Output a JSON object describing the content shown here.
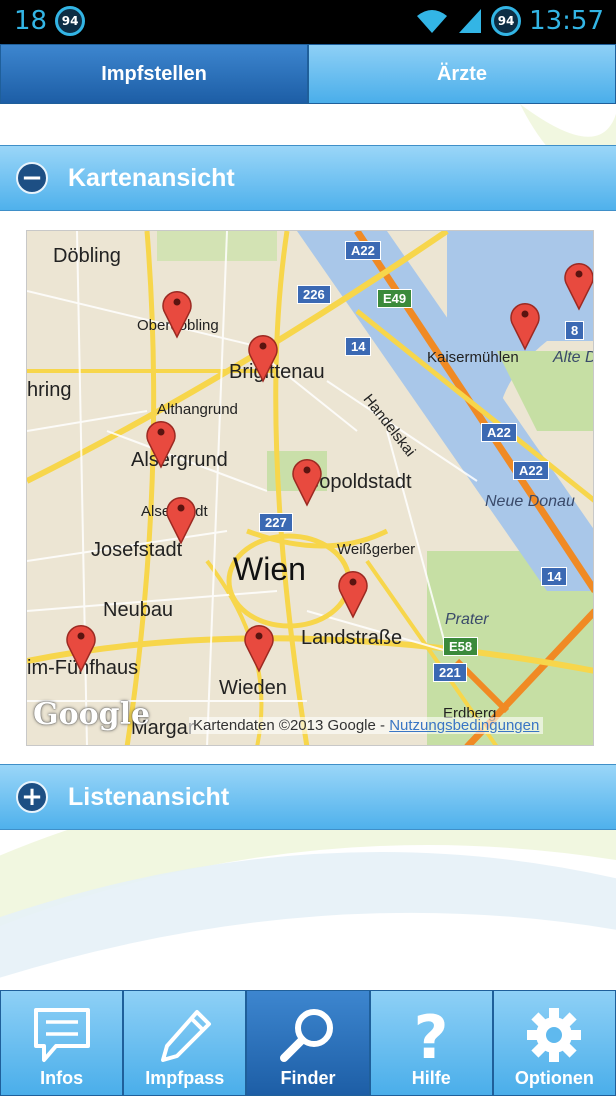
{
  "status_bar": {
    "left_number": "18",
    "badge": "94",
    "right_badge": "94",
    "time": "13:57"
  },
  "tabs": [
    {
      "label": "Impfstellen",
      "active": true
    },
    {
      "label": "Ärzte",
      "active": false
    }
  ],
  "sections": {
    "map_view": {
      "label": "Kartenansicht",
      "state_icon": "minus-icon"
    },
    "list_view": {
      "label": "Listenansicht",
      "state_icon": "plus-icon"
    }
  },
  "map": {
    "city": "Wien",
    "districts": [
      "Döbling",
      "Oberdöbling",
      "Brigittenau",
      "Kaisermühlen",
      "Alte D",
      "hring",
      "Althangrund",
      "Alsergrund",
      "Leopoldstadt",
      "Alserstadt",
      "Josefstadt",
      "Weißgerber",
      "Neubau",
      "Landstraße",
      "im-Fünfhaus",
      "Wieden",
      "Margar",
      "Erdberg",
      "Neue Donau",
      "Prater",
      "Handelskai"
    ],
    "road_shields": [
      "A22",
      "226",
      "E49",
      "14",
      "8",
      "A22",
      "A22",
      "227",
      "14",
      "E58",
      "221"
    ],
    "logo": "Google",
    "copyright": "Kartendaten ©2013 Google -",
    "terms_link": "Nutzungsbedingungen"
  },
  "bottom_nav": [
    {
      "label": "Infos",
      "icon": "message-icon",
      "active": false
    },
    {
      "label": "Impfpass",
      "icon": "pencil-icon",
      "active": false
    },
    {
      "label": "Finder",
      "icon": "search-icon",
      "active": true
    },
    {
      "label": "Hilfe",
      "icon": "question-icon",
      "active": false
    },
    {
      "label": "Optionen",
      "icon": "gear-icon",
      "active": false
    }
  ],
  "colors": {
    "accent_dark": "#1d5ea6",
    "accent_light": "#4aaeea",
    "status_blue": "#33b5e5",
    "pin_red": "#e84a3f"
  }
}
